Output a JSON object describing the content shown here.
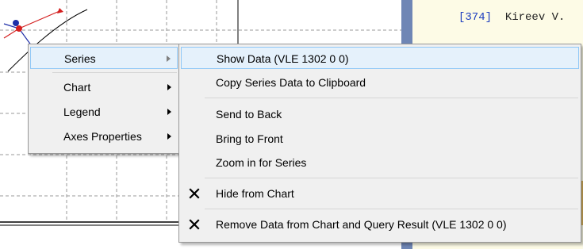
{
  "background": {
    "right_panel_text": {
      "ref_number": "[374]",
      "author": "Kireev V."
    }
  },
  "context_menu": {
    "items": [
      {
        "label": "Series",
        "has_submenu": true,
        "highlighted": true
      },
      {
        "label": "Chart",
        "has_submenu": true
      },
      {
        "label": "Legend",
        "has_submenu": true
      },
      {
        "label": "Axes Properties",
        "has_submenu": true
      }
    ]
  },
  "series_submenu": {
    "items": [
      {
        "label": "Show Data (VLE 1302 0 0)",
        "highlighted": true
      },
      {
        "label": "Copy Series Data to Clipboard"
      },
      {
        "label": "Send to Back"
      },
      {
        "label": "Bring to Front"
      },
      {
        "label": "Zoom in for Series"
      },
      {
        "label": "Hide from Chart",
        "icon": "x-mark-icon"
      },
      {
        "label": "Remove Data from Chart and Query Result (VLE 1302 0 0)",
        "icon": "x-mark-icon"
      }
    ]
  },
  "colors": {
    "menu_background": "#f0f0f0",
    "menu_highlight": "#e5f1fb",
    "menu_highlight_border": "#90c8f6",
    "divider_blue": "#6f86b5",
    "panel_cream": "#fdfbe6",
    "panel_tan": "#d9b25a",
    "series_red": "#d42020",
    "series_blue": "#1f2fa8"
  }
}
